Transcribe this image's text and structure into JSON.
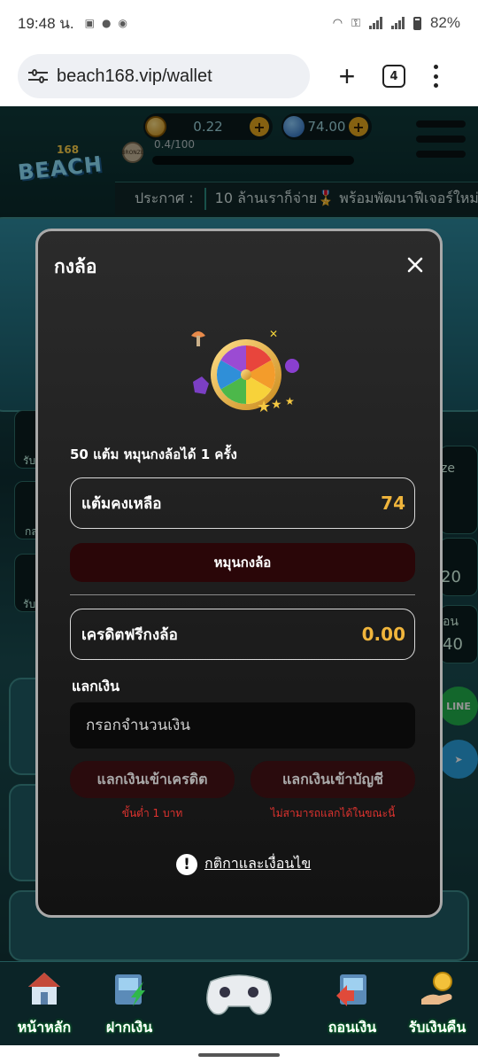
{
  "status_bar": {
    "time": "19:48 น.",
    "battery": "82%"
  },
  "browser": {
    "url": "beach168.vip/wallet",
    "tab_count": "4"
  },
  "header": {
    "logo_text": "BEACH",
    "logo_number": "168",
    "balance": "0.22",
    "gems": "74.00",
    "level_progress": "0.4/100",
    "level_badge": "BRONZE",
    "announce_label": "ประกาศ :",
    "announce_text": "10 ล้านเราก็จ่าย🎖️ พร้อมพัฒนาฟีเจอร์ใหม่"
  },
  "background": {
    "left_labels": [
      "รับ",
      "กล",
      "รับ"
    ],
    "right_labels": [
      "ze",
      "20",
      "อน",
      "40"
    ]
  },
  "modal": {
    "title": "กงล้อ",
    "rule": "50 แต้ม หมุนกงล้อได้ 1 ครั้ง",
    "points_label": "แต้มคงเหลือ",
    "points_value": "74",
    "spin_button": "หมุนกงล้อ",
    "credit_label": "เครดิตฟรีกงล้อ",
    "credit_value": "0.00",
    "exchange_label": "แลกเงิน",
    "amount_placeholder": "กรอกจำนวนเงิน",
    "to_credit_button": "แลกเงินเข้าเครดิต",
    "to_account_button": "แลกเงินเข้าบัญชี",
    "min_note": "ขั้นต่ำ 1 บาท",
    "unavailable_note": "ไม่สามารถแลกได้ในขณะนี้",
    "terms_link": "กติกาและเงื่อนไข"
  },
  "bottom_nav": [
    {
      "label": "หน้าหลัก",
      "icon": "house-icon"
    },
    {
      "label": "ฝากเงิน",
      "icon": "deposit-icon"
    },
    {
      "label": "ถอนเงิน",
      "icon": "withdraw-icon"
    },
    {
      "label": "รับเงินคืน",
      "icon": "cashback-icon"
    }
  ],
  "colors": {
    "accent_gold": "#f0b53c",
    "danger_red": "#e0332f",
    "spin_button_bg": "#2a0608"
  }
}
